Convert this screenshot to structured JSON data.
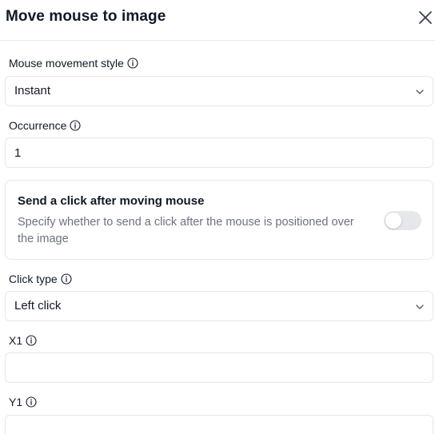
{
  "header": {
    "title": "Move mouse to image"
  },
  "mouse_movement_style": {
    "label": "Mouse movement style",
    "value": "Instant"
  },
  "occurrence": {
    "label": "Occurrence",
    "value": "1"
  },
  "send_click": {
    "title": "Send a click after moving mouse",
    "description": "Specify whether to send a click after the mouse is positioned over the image",
    "enabled": false
  },
  "click_type": {
    "label": "Click type",
    "value": "Left click"
  },
  "x1": {
    "label": "X1",
    "value": ""
  },
  "y1": {
    "label": "Y1",
    "value": ""
  }
}
